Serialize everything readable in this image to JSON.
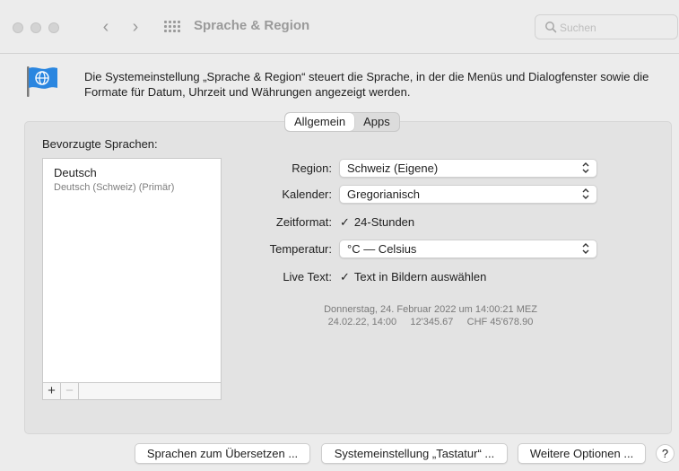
{
  "window": {
    "title": "Sprache & Region",
    "nav_back": "‹",
    "nav_forward": "›"
  },
  "search": {
    "placeholder": "Suchen",
    "value": ""
  },
  "header": {
    "description": "Die Systemeinstellung „Sprache & Region“ steuert die Sprache, in der die Menüs und Dialogfenster sowie die Formate für Datum, Uhrzeit und Währungen angezeigt werden.",
    "icon": "flag-globe-icon"
  },
  "tabs": [
    {
      "label": "Allgemein",
      "active": true
    },
    {
      "label": "Apps",
      "active": false
    }
  ],
  "languages": {
    "label": "Bevorzugte Sprachen:",
    "items": [
      {
        "name": "Deutsch",
        "detail": "Deutsch (Schweiz) (Primär)"
      }
    ],
    "add": "+",
    "remove": "−"
  },
  "settings": {
    "region": {
      "label": "Region:",
      "value": "Schweiz (Eigene)"
    },
    "calendar": {
      "label": "Kalender:",
      "value": "Gregorianisch"
    },
    "time_format": {
      "label": "Zeitformat:",
      "value": "24-Stunden",
      "checked": true
    },
    "temperature": {
      "label": "Temperatur:",
      "value": "°C — Celsius"
    },
    "live_text": {
      "label": "Live Text:",
      "value": "Text in Bildern auswählen",
      "checked": true
    }
  },
  "preview": {
    "line1": "Donnerstag, 24. Februar 2022 um 14:00:21 MEZ",
    "line2": "24.02.22, 14:00     12'345.67     CHF 45'678.90"
  },
  "buttons": {
    "translate": "Sprachen zum Übersetzen ...",
    "keyboard": "Systemeinstellung „Tastatur“ ...",
    "more": "Weitere Optionen ...",
    "help": "?"
  },
  "colors": {
    "window_bg": "#ececec",
    "pane_bg": "#e3e3e3",
    "accent": "#1a73e8"
  }
}
